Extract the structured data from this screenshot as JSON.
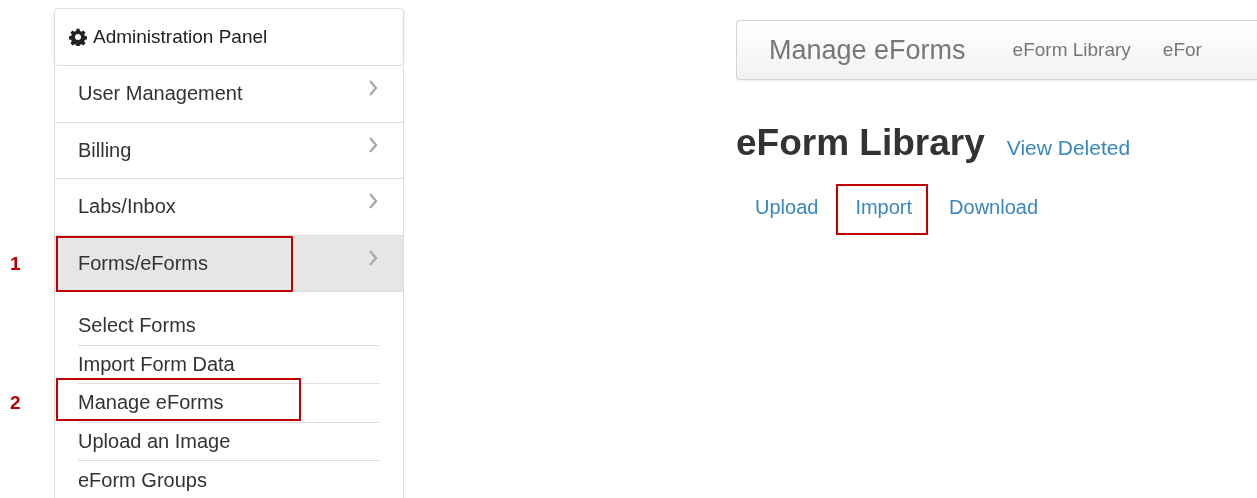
{
  "panel": {
    "title": "Administration Panel",
    "items": [
      {
        "label": "User Management",
        "selected": false,
        "highlighted": false
      },
      {
        "label": "Billing",
        "selected": false,
        "highlighted": false
      },
      {
        "label": "Labs/Inbox",
        "selected": false,
        "highlighted": false
      },
      {
        "label": "Forms/eForms",
        "selected": true,
        "highlighted": true,
        "step": "1",
        "children": [
          {
            "label": "Select Forms",
            "highlighted": false
          },
          {
            "label": "Import Form Data",
            "highlighted": false
          },
          {
            "label": "Manage eForms",
            "highlighted": true,
            "step": "2"
          },
          {
            "label": "Upload an Image",
            "highlighted": false
          },
          {
            "label": "eForm Groups",
            "highlighted": false
          }
        ]
      }
    ]
  },
  "navbar": {
    "brand": "Manage eForms",
    "links": [
      "eForm Library",
      "eFor"
    ]
  },
  "heading": "eForm Library",
  "heading_link": "View Deleted",
  "actions": [
    {
      "label": "Upload",
      "highlighted": false
    },
    {
      "label": "Import",
      "highlighted": true
    },
    {
      "label": "Download",
      "highlighted": false
    }
  ]
}
